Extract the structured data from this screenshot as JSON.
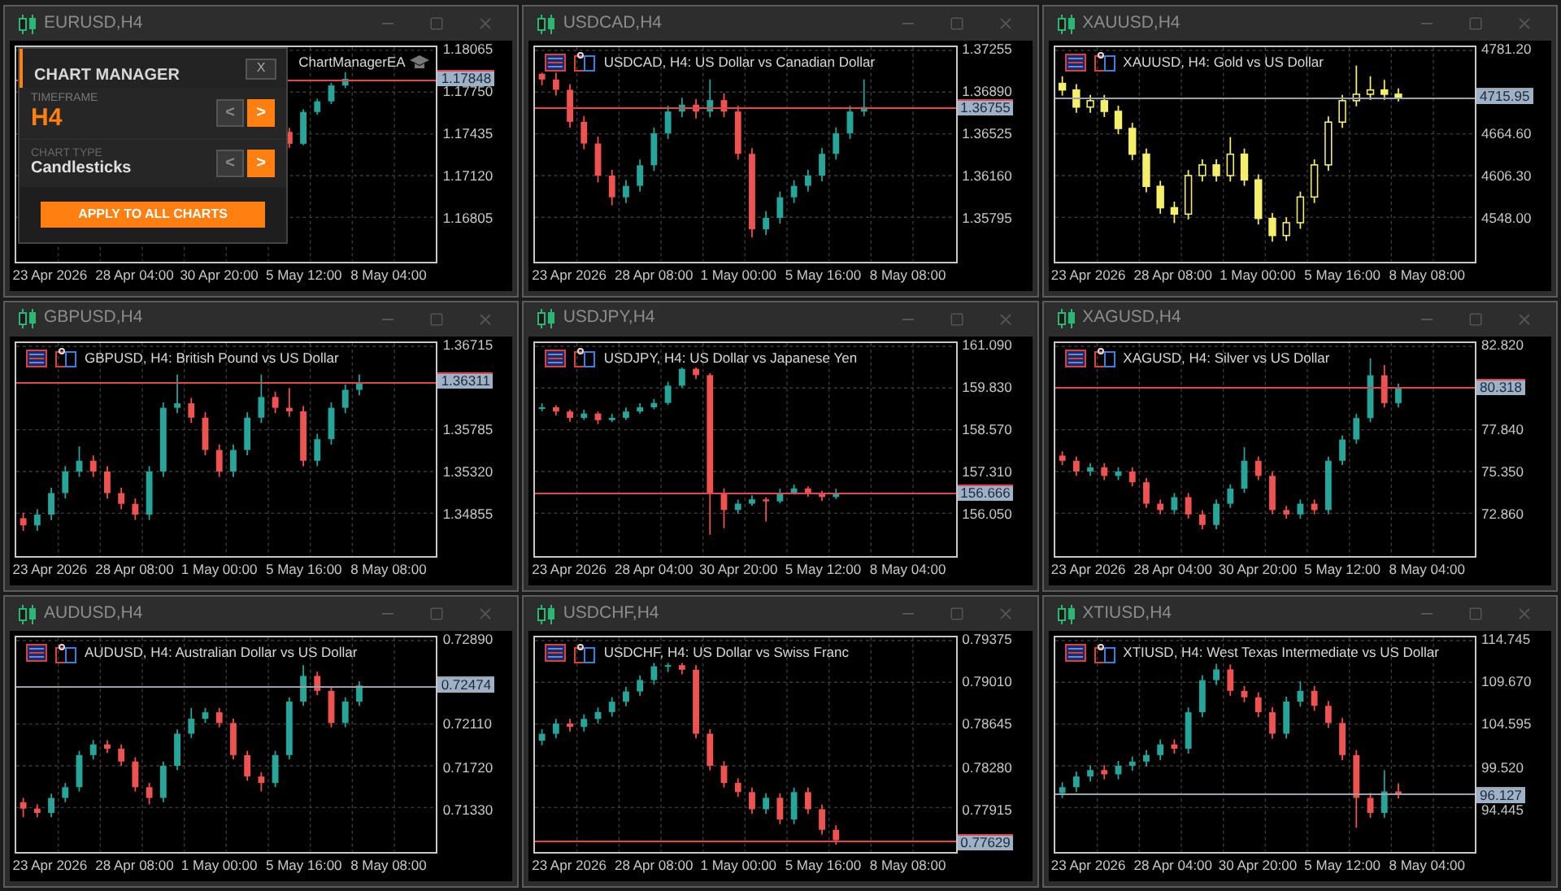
{
  "charts": [
    {
      "title": "EURUSD,H4",
      "expert": "ChartManagerEA",
      "chart_data": {
        "type": "candlestick",
        "ylim": [
          1.16474,
          1.18089
        ],
        "grid": true,
        "ref_lines": [
          {
            "axis": "y",
            "value": 1.17848,
            "label": "1.17848",
            "color": "#e0464f"
          }
        ],
        "categories": [
          null,
          null,
          "23 Apr 2026",
          null,
          null,
          null,
          null,
          null,
          "28 Apr 04:00",
          null,
          null,
          null,
          null,
          null,
          "30 Apr 20:00",
          null,
          null,
          null,
          null,
          null,
          "5 May 12:00",
          null,
          null,
          null,
          null,
          null,
          "8 May 04:00",
          null,
          null,
          null
        ],
        "yticks": [
          {
            "value": 1.18065,
            "label": "1.18065"
          },
          {
            "value": 1.1775,
            "label": "1.17750"
          },
          {
            "value": 1.17435,
            "label": "1.17435"
          },
          {
            "value": 1.1712,
            "label": "1.17120"
          },
          {
            "value": 1.16805,
            "label": "1.16805"
          }
        ],
        "ohlc": [
          null,
          null,
          null,
          null,
          null,
          null,
          null,
          null,
          null,
          null,
          null,
          null,
          null,
          null,
          null,
          null,
          null,
          null,
          null,
          [
            1.1745,
            1.1748,
            1.1733,
            1.1736
          ],
          [
            1.1736,
            1.1762,
            1.1735,
            1.176
          ],
          [
            1.176,
            1.177,
            1.1758,
            1.1768
          ],
          [
            1.1768,
            1.1782,
            1.1766,
            1.178
          ],
          [
            1.178,
            1.179,
            1.1778,
            1.1785
          ],
          null,
          null,
          null,
          null,
          null,
          null
        ]
      }
    },
    {
      "title": "USDCAD,H4",
      "description": "USDCAD, H4:  US Dollar vs Canadian Dollar",
      "chart_data": {
        "type": "candlestick",
        "ylim": [
          1.35411,
          1.37283
        ],
        "grid": true,
        "ref_lines": [
          {
            "axis": "y",
            "value": 1.36755,
            "label": "1.36755",
            "color": "#e0464f"
          }
        ],
        "categories": [
          null,
          null,
          "23 Apr 2026",
          null,
          null,
          null,
          null,
          null,
          "28 Apr 08:00",
          null,
          null,
          null,
          null,
          null,
          "1 May 00:00",
          null,
          null,
          null,
          null,
          null,
          "5 May 16:00",
          null,
          null,
          null,
          null,
          null,
          "8 May 08:00",
          null,
          null,
          null
        ],
        "yticks": [
          {
            "value": 1.37255,
            "label": "1.37255"
          },
          {
            "value": 1.3689,
            "label": "1.36890"
          },
          {
            "value": 1.36525,
            "label": "1.36525"
          },
          {
            "value": 1.3616,
            "label": "1.36160"
          },
          {
            "value": 1.35795,
            "label": "1.35795"
          }
        ],
        "ohlc": [
          [
            1.3705,
            1.3706,
            1.3695,
            1.37
          ],
          [
            1.37,
            1.3706,
            1.3686,
            1.3691
          ],
          [
            1.3691,
            1.3696,
            1.3658,
            1.3663
          ],
          [
            1.3663,
            1.3668,
            1.3639,
            1.3644
          ],
          [
            1.3644,
            1.365,
            1.361,
            1.3616
          ],
          [
            1.3616,
            1.3621,
            1.359,
            1.3597
          ],
          [
            1.3597,
            1.3612,
            1.3592,
            1.3607
          ],
          [
            1.3607,
            1.363,
            1.3602,
            1.3625
          ],
          [
            1.3625,
            1.3658,
            1.362,
            1.3653
          ],
          [
            1.3653,
            1.3677,
            1.3648,
            1.3672
          ],
          [
            1.3672,
            1.3684,
            1.3667,
            1.3678
          ],
          [
            1.3678,
            1.3683,
            1.3666,
            1.3672
          ],
          [
            1.3672,
            1.37,
            1.3667,
            1.3682
          ],
          [
            1.3682,
            1.3688,
            1.3667,
            1.3672
          ],
          [
            1.3672,
            1.3677,
            1.363,
            1.3635
          ],
          [
            1.3635,
            1.364,
            1.3562,
            1.3569
          ],
          [
            1.3569,
            1.3585,
            1.3564,
            1.3579
          ],
          [
            1.3579,
            1.3602,
            1.3574,
            1.3597
          ],
          [
            1.3597,
            1.3612,
            1.3592,
            1.3607
          ],
          [
            1.3607,
            1.3621,
            1.3602,
            1.3616
          ],
          [
            1.3616,
            1.364,
            1.3611,
            1.3635
          ],
          [
            1.3635,
            1.3658,
            1.363,
            1.3653
          ],
          [
            1.3653,
            1.3677,
            1.3648,
            1.3672
          ],
          [
            1.3672,
            1.37,
            1.3668,
            1.3676
          ],
          null,
          null,
          null,
          null,
          null,
          null
        ]
      }
    },
    {
      "title": "XAUUSD,H4",
      "description": "XAUUSD, H4:  Gold vs US Dollar",
      "chart_data": {
        "type": "candlestick",
        "ylim": [
          4486.71,
          4785.68
        ],
        "grid": true,
        "ref_lines": [
          {
            "axis": "y",
            "value": 4715.95,
            "label": "4715.95",
            "color": "#9aa3ad"
          }
        ],
        "categories": [
          null,
          null,
          "23 Apr 2026",
          null,
          null,
          null,
          null,
          null,
          "28 Apr 08:00",
          null,
          null,
          null,
          null,
          null,
          "1 May 00:00",
          null,
          null,
          null,
          null,
          null,
          "5 May 16:00",
          null,
          null,
          null,
          null,
          null,
          "8 May 08:00",
          null,
          null,
          null
        ],
        "yticks": [
          {
            "value": 4781.2,
            "label": "4781.20"
          },
          {
            "value": 4664.6,
            "label": "4664.60"
          },
          {
            "value": 4606.3,
            "label": "4606.30"
          },
          {
            "value": 4548.0,
            "label": "4548.00"
          }
        ],
        "ohlc": [
          [
            4735.0,
            4745.0,
            4718.0,
            4725.9
          ],
          [
            4725.9,
            4734.0,
            4694.0,
            4702.0
          ],
          [
            4702.0,
            4719.0,
            4694.0,
            4710.9
          ],
          [
            4710.9,
            4719.0,
            4688.0,
            4696.0
          ],
          [
            4696.0,
            4704.0,
            4664.0,
            4672.1
          ],
          [
            4672.1,
            4680.0,
            4628.0,
            4636.2
          ],
          [
            4636.2,
            4644.0,
            4583.0,
            4591.3
          ],
          [
            4591.3,
            4599.0,
            4553.0,
            4561.4
          ],
          [
            4561.4,
            4570.0,
            4540.0,
            4552.5
          ],
          [
            4552.5,
            4614.0,
            4545.0,
            4606.3
          ],
          [
            4606.3,
            4629.0,
            4598.0,
            4621.2
          ],
          [
            4621.2,
            4629.0,
            4598.0,
            4606.3
          ],
          [
            4606.3,
            4660.0,
            4598.0,
            4636.2
          ],
          [
            4636.2,
            4644.0,
            4592.0,
            4600.3
          ],
          [
            4600.3,
            4608.0,
            4538.0,
            4546.5
          ],
          [
            4546.5,
            4554.0,
            4514.0,
            4522.6
          ],
          [
            4522.6,
            4548.0,
            4515.0,
            4540.5
          ],
          [
            4540.5,
            4584.0,
            4532.0,
            4576.4
          ],
          [
            4576.4,
            4629.0,
            4568.0,
            4621.2
          ],
          [
            4621.2,
            4689.0,
            4613.0,
            4681.0
          ],
          [
            4681.0,
            4719.0,
            4673.0,
            4710.9
          ],
          [
            4710.9,
            4760.0,
            4703.0,
            4719.9
          ],
          [
            4719.9,
            4745.0,
            4712.0,
            4725.9
          ],
          [
            4725.9,
            4740.0,
            4712.0,
            4719.9
          ],
          [
            4719.9,
            4728.0,
            4710.0,
            4716.0
          ],
          null,
          null,
          null,
          null,
          null
        ]
      }
    },
    {
      "title": "GBPUSD,H4",
      "description": "GBPUSD, H4:  British Pound vs US Dollar",
      "chart_data": {
        "type": "candlestick",
        "ylim": [
          1.34366,
          1.36751
        ],
        "grid": true,
        "ref_lines": [
          {
            "axis": "y",
            "value": 1.36311,
            "label": "1.36311",
            "color": "#e0464f"
          }
        ],
        "categories": [
          null,
          null,
          "23 Apr 2026",
          null,
          null,
          null,
          null,
          null,
          "28 Apr 08:00",
          null,
          null,
          null,
          null,
          null,
          "1 May 00:00",
          null,
          null,
          null,
          null,
          null,
          "5 May 16:00",
          null,
          null,
          null,
          null,
          null,
          "8 May 08:00",
          null,
          null,
          null
        ],
        "yticks": [
          {
            "value": 1.36715,
            "label": "1.36715"
          },
          {
            "value": 1.35785,
            "label": "1.35785"
          },
          {
            "value": 1.3532,
            "label": "1.35320"
          },
          {
            "value": 1.34855,
            "label": "1.34855"
          }
        ],
        "ohlc": [
          [
            1.348,
            1.3486,
            1.3466,
            1.3472
          ],
          [
            1.3472,
            1.349,
            1.3466,
            1.3484
          ],
          [
            1.3484,
            1.3514,
            1.3478,
            1.3508
          ],
          [
            1.3508,
            1.3538,
            1.3502,
            1.3532
          ],
          [
            1.3532,
            1.356,
            1.3526,
            1.3544
          ],
          [
            1.3544,
            1.355,
            1.3526,
            1.3532
          ],
          [
            1.3532,
            1.3538,
            1.3502,
            1.3508
          ],
          [
            1.3508,
            1.3514,
            1.349,
            1.3496
          ],
          [
            1.3496,
            1.3502,
            1.3478,
            1.3484
          ],
          [
            1.3484,
            1.3538,
            1.3478,
            1.3532
          ],
          [
            1.3532,
            1.3609,
            1.3526,
            1.3603
          ],
          [
            1.3603,
            1.364,
            1.3597,
            1.3608
          ],
          [
            1.3608,
            1.3614,
            1.3586,
            1.3592
          ],
          [
            1.3592,
            1.3598,
            1.355,
            1.3556
          ],
          [
            1.3556,
            1.3562,
            1.3526,
            1.3532
          ],
          [
            1.3532,
            1.3562,
            1.3526,
            1.3556
          ],
          [
            1.3556,
            1.3598,
            1.355,
            1.3592
          ],
          [
            1.3592,
            1.364,
            1.3586,
            1.3615
          ],
          [
            1.3615,
            1.3621,
            1.3597,
            1.3603
          ],
          [
            1.3603,
            1.3625,
            1.3593,
            1.3599
          ],
          [
            1.3599,
            1.3605,
            1.3538,
            1.3544
          ],
          [
            1.3544,
            1.3574,
            1.3538,
            1.3568
          ],
          [
            1.3568,
            1.3609,
            1.3562,
            1.3603
          ],
          [
            1.3603,
            1.3629,
            1.3597,
            1.3623
          ],
          [
            1.3623,
            1.364,
            1.3617,
            1.3631
          ],
          null,
          null,
          null,
          null,
          null
        ]
      }
    },
    {
      "title": "USDJPY,H4",
      "description": "USDJPY, H4:  US Dollar vs Japanese Yen",
      "chart_data": {
        "type": "candlestick",
        "ylim": [
          154.725,
          161.187
        ],
        "grid": true,
        "ref_lines": [
          {
            "axis": "y",
            "value": 156.666,
            "label": "156.666",
            "color": "#e0464f"
          }
        ],
        "categories": [
          null,
          null,
          "23 Apr 2026",
          null,
          null,
          null,
          null,
          null,
          "28 Apr 04:00",
          null,
          null,
          null,
          null,
          null,
          "30 Apr 20:00",
          null,
          null,
          null,
          null,
          null,
          "5 May 12:00",
          null,
          null,
          null,
          null,
          null,
          "8 May 04:00",
          null,
          null,
          null
        ],
        "yticks": [
          {
            "value": 161.09,
            "label": "161.090"
          },
          {
            "value": 159.83,
            "label": "159.830"
          },
          {
            "value": 158.57,
            "label": "158.570"
          },
          {
            "value": 157.31,
            "label": "157.310"
          },
          {
            "value": 156.05,
            "label": "156.050"
          }
        ],
        "ohlc": [
          [
            159.2,
            159.37,
            159.13,
            159.25
          ],
          [
            159.25,
            159.31,
            159.0,
            159.12
          ],
          [
            159.12,
            159.18,
            158.81,
            158.93
          ],
          [
            158.93,
            159.18,
            158.87,
            159.06
          ],
          [
            159.06,
            159.12,
            158.74,
            158.86
          ],
          [
            158.86,
            159.05,
            158.8,
            158.93
          ],
          [
            158.93,
            159.24,
            158.87,
            159.12
          ],
          [
            159.12,
            159.37,
            159.06,
            159.25
          ],
          [
            159.25,
            159.5,
            159.19,
            159.38
          ],
          [
            159.38,
            160.02,
            159.32,
            159.9
          ],
          [
            159.9,
            160.45,
            159.84,
            160.41
          ],
          [
            160.41,
            160.45,
            160.1,
            160.22
          ],
          [
            160.22,
            160.28,
            155.4,
            156.67
          ],
          [
            156.67,
            156.8,
            155.6,
            156.15
          ],
          [
            156.15,
            156.46,
            156.03,
            156.34
          ],
          [
            156.34,
            156.59,
            156.28,
            156.47
          ],
          [
            156.47,
            156.53,
            155.8,
            156.41
          ],
          [
            156.41,
            156.79,
            156.35,
            156.67
          ],
          [
            156.67,
            156.92,
            156.61,
            156.8
          ],
          [
            156.8,
            156.86,
            156.55,
            156.67
          ],
          [
            156.67,
            156.73,
            156.42,
            156.54
          ],
          [
            156.54,
            156.79,
            156.48,
            156.67
          ],
          null,
          null,
          null,
          null,
          null,
          null,
          null,
          null
        ]
      }
    },
    {
      "title": "XAGUSD,H4",
      "description": "XAGUSD, H4:  Silver vs US Dollar",
      "chart_data": {
        "type": "candlestick",
        "ylim": [
          70.2425,
          83.0115
        ],
        "grid": true,
        "ref_lines": [
          {
            "axis": "y",
            "value": 80.318,
            "label": "80.318",
            "color": "#e0464f"
          }
        ],
        "categories": [
          null,
          null,
          "23 Apr 2026",
          null,
          null,
          null,
          null,
          null,
          "28 Apr 04:00",
          null,
          null,
          null,
          null,
          null,
          "30 Apr 20:00",
          null,
          null,
          null,
          null,
          null,
          "5 May 12:00",
          null,
          null,
          null,
          null,
          null,
          "8 May 04:00",
          null,
          null,
          null
        ],
        "yticks": [
          {
            "value": 82.82,
            "label": "82.820"
          },
          {
            "value": 77.84,
            "label": "77.840"
          },
          {
            "value": 75.35,
            "label": "75.350"
          },
          {
            "value": 72.86,
            "label": "72.860"
          }
        ],
        "ohlc": [
          [
            76.3,
            76.55,
            75.74,
            75.99
          ],
          [
            75.99,
            76.24,
            75.1,
            75.35
          ],
          [
            75.35,
            75.85,
            75.1,
            75.6
          ],
          [
            75.6,
            75.85,
            74.84,
            75.09
          ],
          [
            75.09,
            75.6,
            74.84,
            75.35
          ],
          [
            75.35,
            75.6,
            74.46,
            74.71
          ],
          [
            74.71,
            74.96,
            73.18,
            73.43
          ],
          [
            73.43,
            73.68,
            72.8,
            73.05
          ],
          [
            73.05,
            74.07,
            72.8,
            73.82
          ],
          [
            73.82,
            74.07,
            72.54,
            72.79
          ],
          [
            72.79,
            73.04,
            71.91,
            72.16
          ],
          [
            72.16,
            73.68,
            71.91,
            73.43
          ],
          [
            73.43,
            74.58,
            73.18,
            74.33
          ],
          [
            74.33,
            76.8,
            74.08,
            75.99
          ],
          [
            75.99,
            76.24,
            74.84,
            75.09
          ],
          [
            75.09,
            75.34,
            72.8,
            73.05
          ],
          [
            73.05,
            73.3,
            72.54,
            72.79
          ],
          [
            72.79,
            73.68,
            72.54,
            73.43
          ],
          [
            73.43,
            73.68,
            72.8,
            73.05
          ],
          [
            73.05,
            76.24,
            72.8,
            75.99
          ],
          [
            75.99,
            77.51,
            75.74,
            77.26
          ],
          [
            77.26,
            78.79,
            77.01,
            78.54
          ],
          [
            78.54,
            82.1,
            78.29,
            81.09
          ],
          [
            81.09,
            81.7,
            79.18,
            79.43
          ],
          [
            79.43,
            80.6,
            79.18,
            80.32
          ],
          null,
          null,
          null,
          null,
          null
        ]
      }
    },
    {
      "title": "AUDUSD,H4",
      "description": "AUDUSD, H4:  Australian Dollar vs US Dollar",
      "chart_data": {
        "type": "candlestick",
        "ylim": [
          0.7092,
          0.7292
        ],
        "grid": true,
        "ref_lines": [
          {
            "axis": "y",
            "value": 0.72474,
            "label": "0.72474",
            "color": "#9aa3ad"
          }
        ],
        "categories": [
          null,
          null,
          "23 Apr 2026",
          null,
          null,
          null,
          null,
          null,
          "28 Apr 08:00",
          null,
          null,
          null,
          null,
          null,
          "1 May 00:00",
          null,
          null,
          null,
          null,
          null,
          "5 May 16:00",
          null,
          null,
          null,
          null,
          null,
          "8 May 08:00",
          null,
          null,
          null
        ],
        "yticks": [
          {
            "value": 0.7289,
            "label": "0.72890"
          },
          {
            "value": 0.7211,
            "label": "0.72110"
          },
          {
            "value": 0.7172,
            "label": "0.71720"
          },
          {
            "value": 0.7133,
            "label": "0.71330"
          }
        ],
        "ohlc": [
          [
            0.7138,
            0.7142,
            0.7124,
            0.7132
          ],
          [
            0.7132,
            0.7136,
            0.7124,
            0.7128
          ],
          [
            0.7128,
            0.7146,
            0.7124,
            0.7142
          ],
          [
            0.7142,
            0.7156,
            0.7138,
            0.7152
          ],
          [
            0.7152,
            0.7186,
            0.7148,
            0.7182
          ],
          [
            0.7182,
            0.7196,
            0.7178,
            0.7192
          ],
          [
            0.7192,
            0.7196,
            0.7184,
            0.7188
          ],
          [
            0.7188,
            0.7192,
            0.7172,
            0.7176
          ],
          [
            0.7176,
            0.718,
            0.7148,
            0.7152
          ],
          [
            0.7152,
            0.7156,
            0.7136,
            0.7142
          ],
          [
            0.7142,
            0.7176,
            0.7138,
            0.7172
          ],
          [
            0.7172,
            0.7206,
            0.7168,
            0.7202
          ],
          [
            0.7202,
            0.7226,
            0.7198,
            0.7216
          ],
          [
            0.7216,
            0.7226,
            0.7212,
            0.7222
          ],
          [
            0.7222,
            0.7226,
            0.7208,
            0.7212
          ],
          [
            0.7212,
            0.7216,
            0.7178,
            0.7182
          ],
          [
            0.7182,
            0.7186,
            0.7158,
            0.7162
          ],
          [
            0.7162,
            0.7166,
            0.7148,
            0.7156
          ],
          [
            0.7156,
            0.7186,
            0.7152,
            0.7182
          ],
          [
            0.7182,
            0.7236,
            0.7178,
            0.7232
          ],
          [
            0.7232,
            0.7266,
            0.7228,
            0.7256
          ],
          [
            0.7256,
            0.726,
            0.7238,
            0.7242
          ],
          [
            0.7242,
            0.7246,
            0.7208,
            0.7212
          ],
          [
            0.7212,
            0.7236,
            0.7208,
            0.7232
          ],
          [
            0.7232,
            0.7251,
            0.7228,
            0.7247
          ],
          null,
          null,
          null,
          null,
          null
        ]
      }
    },
    {
      "title": "USDCHF,H4",
      "description": "USDCHF, H4:  US Dollar vs Swiss Franc",
      "chart_data": {
        "type": "candlestick",
        "ylim": [
          0.77531,
          0.79403
        ],
        "grid": true,
        "ref_lines": [
          {
            "axis": "y",
            "value": 0.77629,
            "label": "0.77629",
            "color": "#e0464f"
          }
        ],
        "categories": [
          null,
          null,
          "23 Apr 2026",
          null,
          null,
          null,
          null,
          null,
          "28 Apr 08:00",
          null,
          null,
          null,
          null,
          null,
          "1 May 00:00",
          null,
          null,
          null,
          null,
          null,
          "5 May 16:00",
          null,
          null,
          null,
          null,
          null,
          "8 May 08:00",
          null,
          null,
          null
        ],
        "yticks": [
          {
            "value": 0.79375,
            "label": "0.79375"
          },
          {
            "value": 0.7901,
            "label": "0.79010"
          },
          {
            "value": 0.78645,
            "label": "0.78645"
          },
          {
            "value": 0.7828,
            "label": "0.78280"
          },
          {
            "value": 0.77915,
            "label": "0.77915"
          }
        ],
        "ohlc": [
          [
            0.785,
            0.786,
            0.7846,
            0.7856
          ],
          [
            0.7856,
            0.7869,
            0.7852,
            0.7865
          ],
          [
            0.7865,
            0.7869,
            0.7858,
            0.7862
          ],
          [
            0.7862,
            0.7873,
            0.7858,
            0.7869
          ],
          [
            0.7869,
            0.7879,
            0.7865,
            0.7875
          ],
          [
            0.7875,
            0.7888,
            0.7871,
            0.7884
          ],
          [
            0.7884,
            0.7897,
            0.788,
            0.7893
          ],
          [
            0.7893,
            0.7907,
            0.7889,
            0.7903
          ],
          [
            0.7903,
            0.7918,
            0.7899,
            0.7915
          ],
          [
            0.7915,
            0.7918,
            0.791,
            0.7916
          ],
          [
            0.7916,
            0.7918,
            0.7908,
            0.7912
          ],
          [
            0.7912,
            0.7916,
            0.7852,
            0.7856
          ],
          [
            0.7856,
            0.786,
            0.7824,
            0.7828
          ],
          [
            0.7828,
            0.7832,
            0.7809,
            0.7813
          ],
          [
            0.7813,
            0.7817,
            0.7801,
            0.7805
          ],
          [
            0.7805,
            0.7809,
            0.7786,
            0.779
          ],
          [
            0.779,
            0.7804,
            0.7786,
            0.78
          ],
          [
            0.78,
            0.7804,
            0.7777,
            0.7781
          ],
          [
            0.7781,
            0.7809,
            0.7777,
            0.7805
          ],
          [
            0.7805,
            0.7809,
            0.7786,
            0.779
          ],
          [
            0.779,
            0.7794,
            0.7768,
            0.7772
          ],
          [
            0.7772,
            0.7776,
            0.7759,
            0.7763
          ],
          null,
          null,
          null,
          null,
          null,
          null,
          null,
          null
        ]
      }
    },
    {
      "title": "XTIUSD,H4",
      "description": "XTIUSD, H4:  West Texas Intermediate vs US Dollar",
      "chart_data": {
        "type": "candlestick",
        "ylim": [
          89.109,
          115.135
        ],
        "grid": true,
        "ref_lines": [
          {
            "axis": "y",
            "value": 96.127,
            "label": "96.127",
            "color": "#9aa3ad"
          }
        ],
        "categories": [
          null,
          null,
          "23 Apr 2026",
          null,
          null,
          null,
          null,
          null,
          "28 Apr 04:00",
          null,
          null,
          null,
          null,
          null,
          "30 Apr 20:00",
          null,
          null,
          null,
          null,
          null,
          "5 May 12:00",
          null,
          null,
          null,
          null,
          null,
          "8 May 04:00",
          null,
          null,
          null
        ],
        "yticks": [
          {
            "value": 114.745,
            "label": "114.745"
          },
          {
            "value": 109.67,
            "label": "109.670"
          },
          {
            "value": 104.595,
            "label": "104.595"
          },
          {
            "value": 99.52,
            "label": "99.520"
          },
          {
            "value": 94.445,
            "label": "94.445"
          }
        ],
        "ohlc": [
          [
            96.2,
            97.52,
            95.6,
            96.92
          ],
          [
            96.92,
            98.82,
            96.32,
            98.22
          ],
          [
            98.22,
            99.6,
            97.62,
            99.0
          ],
          [
            99.0,
            99.6,
            97.88,
            98.48
          ],
          [
            98.48,
            100.12,
            97.88,
            99.52
          ],
          [
            99.52,
            100.64,
            98.92,
            100.04
          ],
          [
            100.04,
            101.42,
            99.44,
            100.82
          ],
          [
            100.82,
            102.72,
            100.22,
            102.12
          ],
          [
            102.12,
            102.72,
            101.0,
            101.6
          ],
          [
            101.6,
            106.63,
            101.0,
            106.03
          ],
          [
            106.03,
            110.53,
            105.43,
            109.93
          ],
          [
            109.93,
            111.9,
            109.33,
            111.24
          ],
          [
            111.24,
            111.84,
            108.03,
            108.63
          ],
          [
            108.63,
            109.23,
            107.25,
            107.85
          ],
          [
            107.85,
            108.45,
            105.43,
            106.03
          ],
          [
            106.03,
            106.63,
            102.83,
            103.43
          ],
          [
            103.43,
            107.93,
            102.83,
            107.33
          ],
          [
            107.33,
            109.8,
            106.73,
            108.63
          ],
          [
            108.63,
            109.23,
            106.21,
            106.81
          ],
          [
            106.81,
            107.41,
            104.13,
            104.73
          ],
          [
            104.73,
            105.33,
            100.22,
            100.82
          ],
          [
            100.82,
            101.42,
            92.0,
            95.62
          ],
          [
            95.62,
            96.22,
            93.2,
            93.8
          ],
          [
            93.8,
            99.0,
            93.2,
            96.4
          ],
          [
            96.4,
            97.4,
            95.53,
            96.13
          ],
          null,
          null,
          null,
          null,
          null
        ]
      }
    }
  ],
  "chart_manager": {
    "title": "CHART MANAGER",
    "close": "X",
    "timeframe_label": "TIMEFRAME",
    "timeframe": "H4",
    "timeframe_buttons": [
      "<",
      ">"
    ],
    "chart_type_label": "CHART TYPE",
    "chart_type": "Candlesticks",
    "chart_type_buttons": [
      "<",
      ">"
    ],
    "apply": "APPLY TO ALL CHARTS"
  }
}
